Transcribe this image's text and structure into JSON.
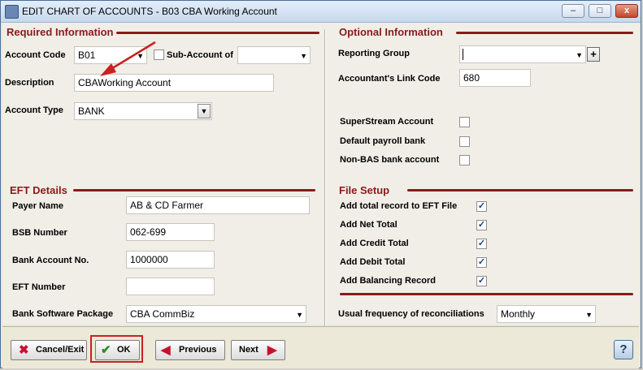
{
  "window": {
    "title": "EDIT CHART OF ACCOUNTS - B03 CBA Working Account",
    "minimize_label": "–",
    "restore_label": "□",
    "close_label": "x"
  },
  "required": {
    "title": "Required Information",
    "account_code_label": "Account Code",
    "account_code_value": "B01",
    "sub_account_label": "Sub-Account of",
    "sub_account_value": "",
    "description_label": "Description",
    "description_value": "CBAWorking Account",
    "account_type_label": "Account Type",
    "account_type_value": "BANK"
  },
  "optional": {
    "title": "Optional Information",
    "reporting_group_label": "Reporting Group",
    "reporting_group_value": "",
    "accountant_link_label": "Accountant's Link Code",
    "accountant_link_value": "680",
    "superstream_label": "SuperStream Account",
    "default_payroll_label": "Default payroll bank",
    "non_bas_label": "Non-BAS bank account"
  },
  "eft": {
    "title": "EFT Details",
    "payer_name_label": "Payer Name",
    "payer_name_value": "AB & CD Farmer",
    "bsb_label": "BSB Number",
    "bsb_value": "062-699",
    "bank_account_label": "Bank Account No.",
    "bank_account_value": "1000000",
    "eft_number_label": "EFT Number",
    "eft_number_value": "",
    "bank_software_label": "Bank Software Package",
    "bank_software_value": "CBA CommBiz"
  },
  "file_setup": {
    "title": "File Setup",
    "total_record_label": "Add total record to EFT File",
    "net_total_label": "Add Net Total",
    "credit_total_label": "Add Credit Total",
    "debit_total_label": "Add Debit Total",
    "balancing_record_label": "Add Balancing Record",
    "frequency_label": "Usual frequency of reconciliations",
    "frequency_value": "Monthly"
  },
  "buttons": {
    "cancel_label": "Cancel/Exit",
    "ok_label": "OK",
    "previous_label": "Previous",
    "next_label": "Next",
    "help_label": "?"
  },
  "colors": {
    "section_red": "#8b1a1a",
    "annotation_red": "#cc2020",
    "check_blue": "#1a3f7a"
  }
}
